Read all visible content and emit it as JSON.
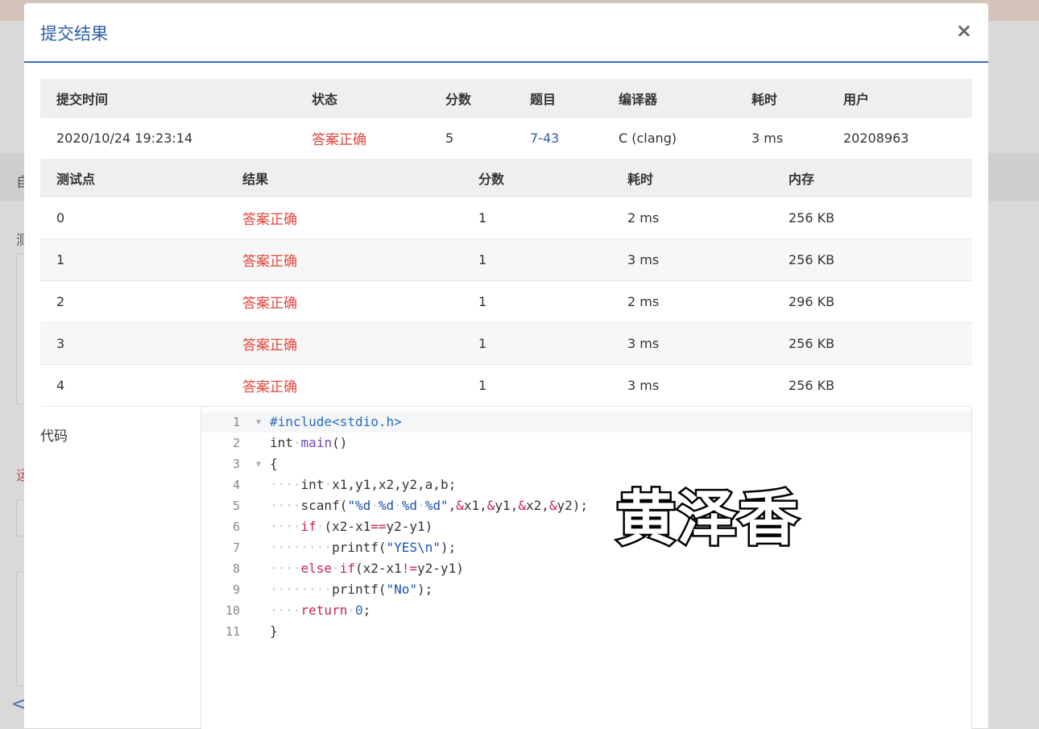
{
  "modal": {
    "title": "提交结果",
    "close": "×"
  },
  "summary": {
    "headers": [
      "提交时间",
      "状态",
      "分数",
      "题目",
      "编译器",
      "耗时",
      "用户"
    ],
    "row": {
      "time": "2020/10/24 19:23:14",
      "status": "答案正确",
      "score": "5",
      "problem": "7-43",
      "compiler": "C (clang)",
      "duration": "3 ms",
      "user": "20208963"
    }
  },
  "tests": {
    "headers": [
      "测试点",
      "结果",
      "分数",
      "耗时",
      "内存"
    ],
    "rows": [
      {
        "id": "0",
        "result": "答案正确",
        "score": "1",
        "time": "2 ms",
        "memory": "256 KB"
      },
      {
        "id": "1",
        "result": "答案正确",
        "score": "1",
        "time": "3 ms",
        "memory": "256 KB"
      },
      {
        "id": "2",
        "result": "答案正确",
        "score": "1",
        "time": "2 ms",
        "memory": "296 KB"
      },
      {
        "id": "3",
        "result": "答案正确",
        "score": "1",
        "time": "3 ms",
        "memory": "256 KB"
      },
      {
        "id": "4",
        "result": "答案正确",
        "score": "1",
        "time": "3 ms",
        "memory": "256 KB"
      }
    ]
  },
  "code": {
    "label": "代码",
    "lines": [
      "#include<stdio.h>",
      "int main()",
      "{",
      "    int x1,y1,x2,y2,a,b;",
      "    scanf(\"%d %d %d %d\",&x1,&y1,&x2,&y2);",
      "    if (x2-x1==y2-y1)",
      "        printf(\"YES\\n\");",
      "    else if(x2-x1!=y2-y1)",
      "        printf(\"No\");",
      "    return 0;",
      "}"
    ]
  },
  "watermark": "黄泽香",
  "background": {
    "chars": [
      "自",
      "测",
      "运",
      "<"
    ]
  },
  "colors": {
    "accent": "#2c5fa6",
    "status_ok": "#e0463c",
    "header_bg": "#efefef"
  }
}
